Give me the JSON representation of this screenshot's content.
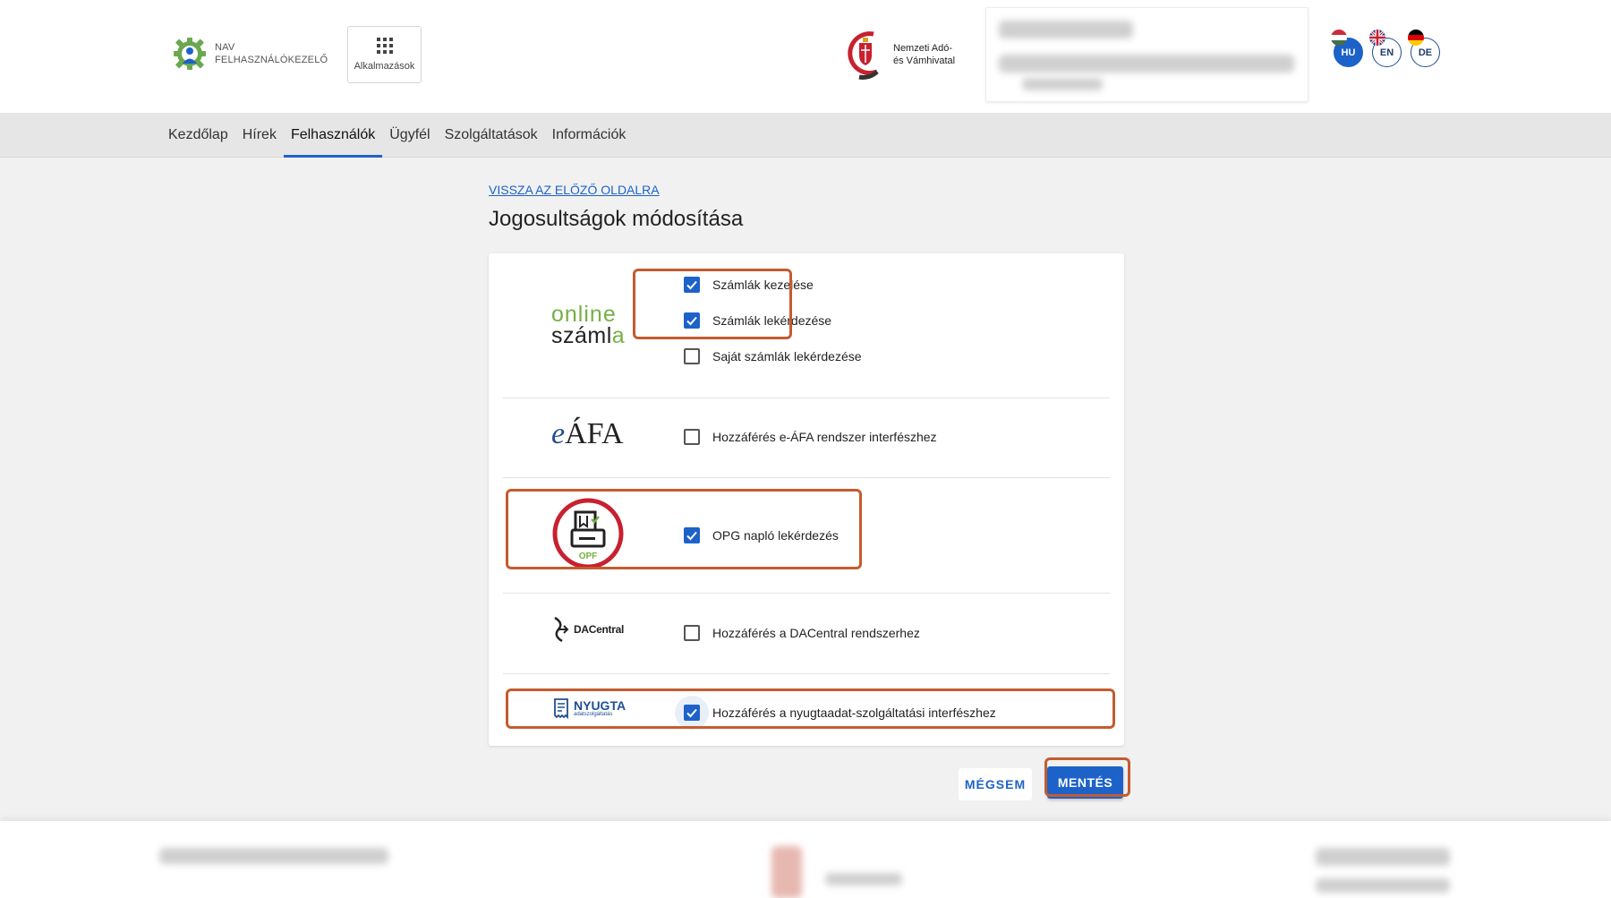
{
  "header": {
    "brand_line1": "NAV",
    "brand_line2": "FELHASZNÁLÓKEZELŐ",
    "apps_label": "Alkalmazások",
    "nav_logo_line1": "Nemzeti Adó-",
    "nav_logo_line2": "és Vámhivatal",
    "languages": [
      "HU",
      "EN",
      "DE"
    ],
    "active_language": "HU"
  },
  "nav": {
    "items": [
      "Kezdőlap",
      "Hírek",
      "Felhasználók",
      "Ügyfél",
      "Szolgáltatások",
      "Információk"
    ],
    "active": "Felhasználók"
  },
  "main": {
    "back_link": "VISSZA AZ ELŐZŐ OLDALRA",
    "title": "Jogosultságok módosítása",
    "sections": [
      {
        "logo": "online számla",
        "logo_line1": "online",
        "logo_line2": "száml",
        "logo_line2_tail": "a",
        "permissions": [
          {
            "label": "Számlák kezelése",
            "checked": true
          },
          {
            "label": "Számlák lekérdezése",
            "checked": true
          },
          {
            "label": "Saját számlák lekérdezése",
            "checked": false
          }
        ]
      },
      {
        "logo": "eÁFA",
        "logo_e": "e",
        "logo_rest": "ÁFA",
        "permissions": [
          {
            "label": "Hozzáférés e-ÁFA rendszer interfészhez",
            "checked": false
          }
        ]
      },
      {
        "logo": "OPF",
        "permissions": [
          {
            "label": "OPG napló lekérdezés",
            "checked": true
          }
        ]
      },
      {
        "logo": "DACentral",
        "permissions": [
          {
            "label": "Hozzáférés a DACentral rendszerhez",
            "checked": false
          }
        ]
      },
      {
        "logo": "NYUGTA adatszolgáltatás",
        "logo_line1": "NYUGTA",
        "logo_line2": "adatszolgáltatás",
        "permissions": [
          {
            "label": "Hozzáférés a nyugtaadat-szolgáltatási interfészhez",
            "checked": true
          }
        ]
      }
    ]
  },
  "actions": {
    "cancel": "MÉGSEM",
    "save": "MENTÉS"
  },
  "colors": {
    "primary": "#1d62c9",
    "highlight": "#c45c2e",
    "logo_green": "#76b043"
  },
  "icons": [
    "nav-user-gear-icon",
    "apps-grid-icon",
    "nav-crest-icon",
    "checkbox-check-icon",
    "opf-cash-register-icon",
    "dacentral-icon",
    "nyugta-receipt-icon"
  ]
}
